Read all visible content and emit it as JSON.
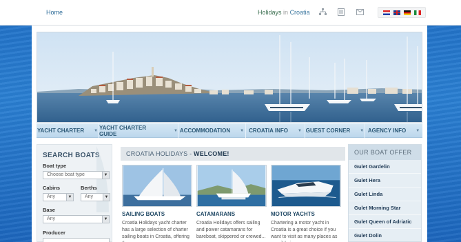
{
  "header": {
    "home": "Home",
    "holidays": "Holidays",
    "in": "in",
    "croatia": "Croatia",
    "icons": [
      "sitemap-icon",
      "document-icon",
      "mail-icon"
    ],
    "languages": [
      "hr",
      "en",
      "de",
      "it"
    ]
  },
  "menu": [
    {
      "label": "Yacht Charter"
    },
    {
      "label": "Yacht Charter Guide"
    },
    {
      "label": "Accommodation"
    },
    {
      "label": "Croatia Info"
    },
    {
      "label": "Guest Corner"
    },
    {
      "label": "Agency Info"
    }
  ],
  "search": {
    "title": "SEARCH BOATS",
    "boat_type_label": "Boat type",
    "boat_type_value": "Choose boat type",
    "cabins_label": "Cabins",
    "cabins_value": "Any",
    "berths_label": "Berths",
    "berths_value": "Any",
    "base_label": "Base",
    "base_value": "Any",
    "producer_label": "Producer"
  },
  "welcome": {
    "prefix": "CROATIA HOLIDAYS",
    "dash": "-",
    "suffix": "WELCOME!"
  },
  "cards": [
    {
      "title": "SAILING BOATS",
      "text": "Croatia Holidays yacht charter has a large selection of charter sailing boats in Croatia, offering the..."
    },
    {
      "title": "CATAMARANS",
      "text": "Croatia Holidays offers sailing and power catamarans for bareboat, skippered or crewed..."
    },
    {
      "title": "MOTOR YACHTS",
      "text": "Chartering a motor yacht in Croatia is a great choice if you want to visit as many places as possible in..."
    }
  ],
  "offer": {
    "title": "OUR BOAT OFFER",
    "items": [
      "Gulet Gardelin",
      "Gulet Hera",
      "Gulet Linda",
      "Gulet Morning Star",
      "Gulet Queen of Adriatic",
      "Gulet Dolin"
    ]
  },
  "colors": {
    "accent": "#2b5876",
    "background": "#1f6fc6"
  }
}
